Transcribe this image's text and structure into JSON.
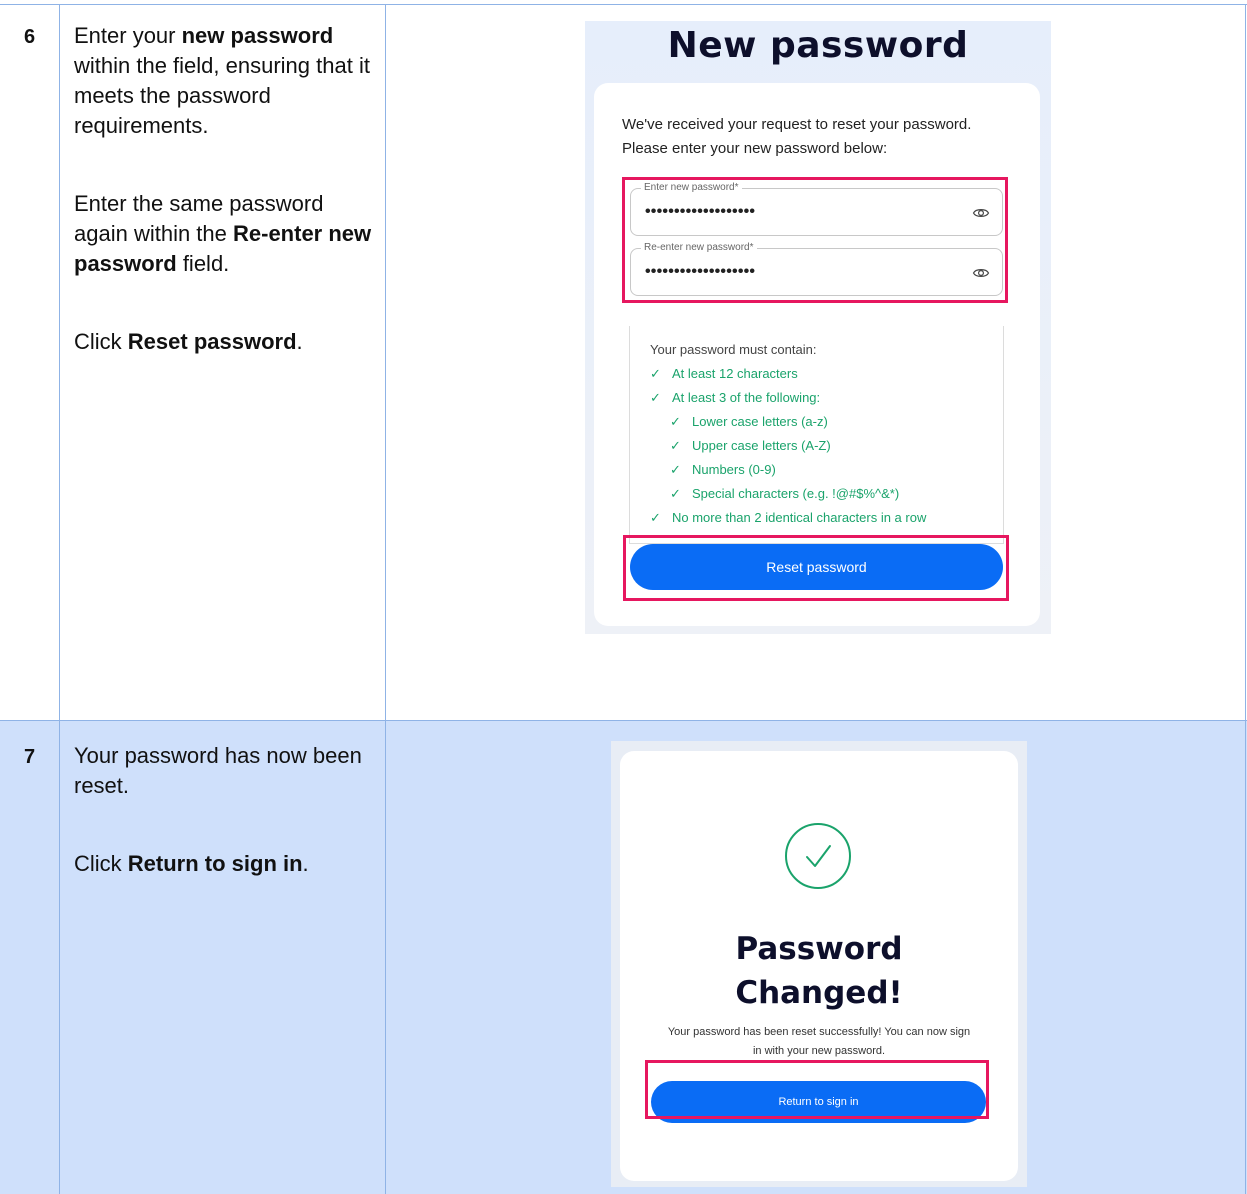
{
  "steps": [
    {
      "number": "6",
      "instructions": {
        "p1_a": "Enter your ",
        "p1_b": "new password",
        "p1_c": " within the field, ensuring that it meets the password requirements.",
        "p2_a": "Enter the same password again within the ",
        "p2_b": "Re-enter new password",
        "p2_c": " field.",
        "p3_a": "Click ",
        "p3_b": "Reset password",
        "p3_c": "."
      },
      "screenshot": {
        "title": "New password",
        "message_line1": "We've received your request to reset your password.",
        "message_line2": "Please enter your new password below:",
        "field1_label": "Enter new password*",
        "field1_value": "•••••••••••••••••••",
        "field2_label": "Re-enter new password*",
        "field2_value": "•••••••••••••••••••",
        "requirements_title": "Your password must contain:",
        "requirements": [
          "At least 12 characters",
          "At least 3 of the following:",
          "Lower case letters (a-z)",
          "Upper case letters (A-Z)",
          "Numbers (0-9)",
          "Special characters (e.g. !@#$%^&*)",
          "No more than 2 identical characters in a row"
        ],
        "check_glyph": "✓",
        "button_label": "Reset password"
      }
    },
    {
      "number": "7",
      "instructions": {
        "p1": "Your password has now been reset.",
        "p2_a": "Click ",
        "p2_b": "Return to sign in",
        "p2_c": "."
      },
      "screenshot": {
        "title_line1": "Password",
        "title_line2": "Changed!",
        "message_line1": "Your password has been reset successfully! You can now sign",
        "message_line2": "in with your new password.",
        "button_label": "Return to sign in"
      }
    }
  ],
  "colors": {
    "highlight": "#e6175f",
    "button": "#0a6cf5",
    "success": "#1aa36b",
    "row_alt": "#cfe0fb",
    "grid": "#8fb3e6"
  }
}
